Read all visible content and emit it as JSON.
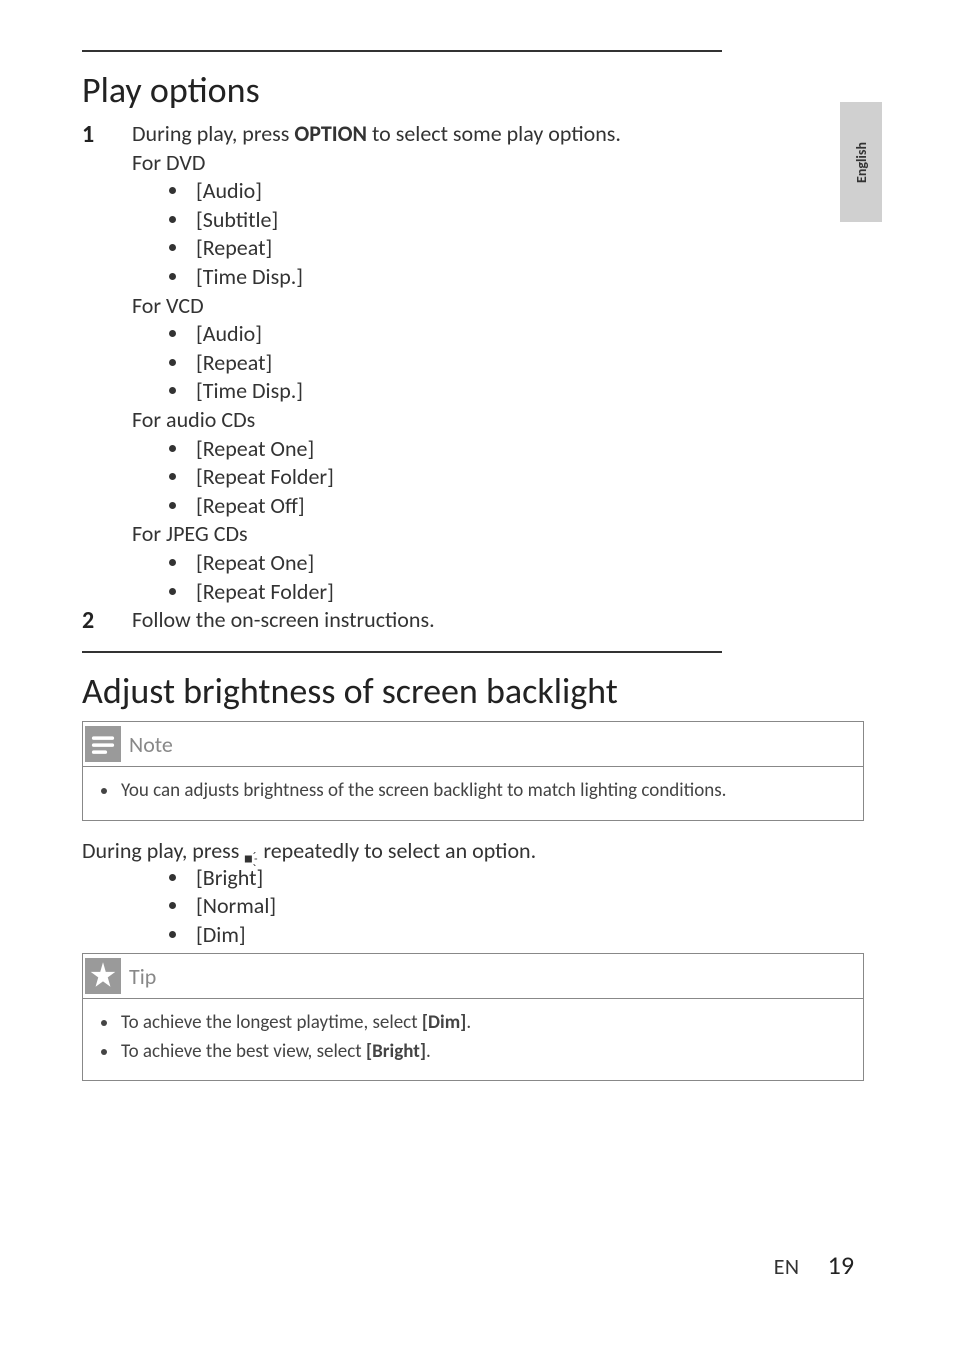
{
  "sidebar": {
    "language": "English"
  },
  "section1": {
    "title": "Play options",
    "step1_prefix": "During play, press ",
    "step1_bold": "OPTION",
    "step1_suffix": " to select some play options.",
    "dvd": {
      "label": "For DVD",
      "items": [
        "[Audio]",
        "[Subtitle]",
        "[Repeat]",
        "[Time Disp.]"
      ]
    },
    "vcd": {
      "label": "For VCD",
      "items": [
        "[Audio]",
        "[Repeat]",
        "[Time Disp.]"
      ]
    },
    "audiocd": {
      "label": "For audio CDs",
      "items": [
        "[Repeat One]",
        "[Repeat Folder]",
        "[Repeat Off]"
      ]
    },
    "jpegcd": {
      "label": "For JPEG CDs",
      "items": [
        "[Repeat One]",
        "[Repeat Folder]"
      ]
    },
    "step2": "Follow the on-screen instructions."
  },
  "section2": {
    "title": "Adjust brightness of screen backlight",
    "note": {
      "label": "Note",
      "items": [
        "You can adjusts brightness of the screen backlight to match lighting conditions."
      ]
    },
    "instruction_prefix": "During play, press ",
    "instruction_suffix": " repeatedly to select an option.",
    "options": [
      "[Bright]",
      "[Normal]",
      "[Dim]"
    ],
    "tip": {
      "label": "Tip",
      "items": [
        {
          "prefix": "To achieve the longest playtime, select ",
          "bold": "[Dim]",
          "suffix": "."
        },
        {
          "prefix": "To achieve the best view, select ",
          "bold": "[Bright]",
          "suffix": "."
        }
      ]
    }
  },
  "footer": {
    "lang": "EN",
    "page": "19"
  }
}
